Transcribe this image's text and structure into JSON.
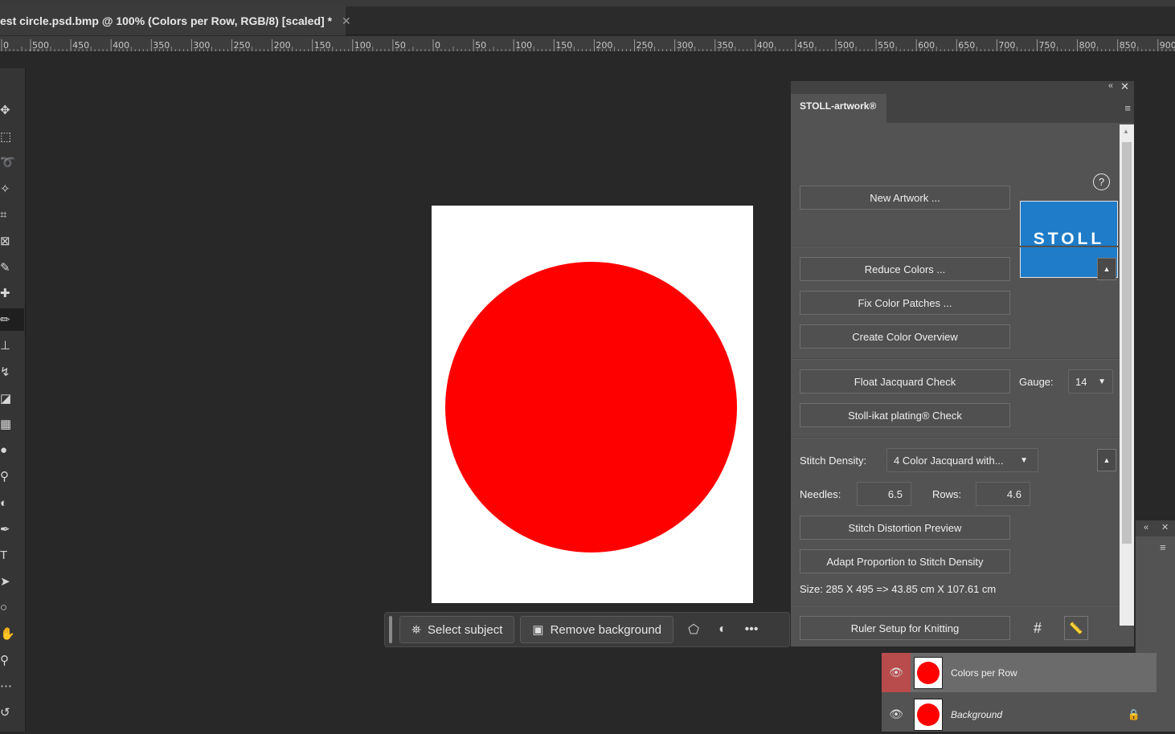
{
  "document_tab": {
    "title": "est circle.psd.bmp @ 100% (Colors per Row, RGB/8) [scaled] *",
    "close_glyph": "✕"
  },
  "ruler": {
    "labels": [
      "0",
      "500",
      "450",
      "400",
      "350",
      "300",
      "250",
      "200",
      "150",
      "100",
      "50",
      "0",
      "50",
      "100",
      "150",
      "200",
      "250",
      "300",
      "350",
      "400",
      "450",
      "500",
      "550",
      "600",
      "650",
      "700",
      "750",
      "800",
      "850",
      "900"
    ]
  },
  "toolbar": {
    "tools": [
      {
        "name": "move-tool-icon",
        "glyph": "✥"
      },
      {
        "name": "marquee-tool-icon",
        "glyph": "⬚"
      },
      {
        "name": "lasso-tool-icon",
        "glyph": "➰"
      },
      {
        "name": "magic-wand-icon",
        "glyph": "✧"
      },
      {
        "name": "crop-tool-icon",
        "glyph": "⌗"
      },
      {
        "name": "frame-tool-icon",
        "glyph": "⊠"
      },
      {
        "name": "eyedropper-icon",
        "glyph": "✎"
      },
      {
        "name": "healing-brush-icon",
        "glyph": "✚"
      },
      {
        "name": "pencil-tool-icon",
        "glyph": "✏"
      },
      {
        "name": "stamp-tool-icon",
        "glyph": "⊥"
      },
      {
        "name": "history-brush-icon",
        "glyph": "↯"
      },
      {
        "name": "eraser-tool-icon",
        "glyph": "◪"
      },
      {
        "name": "gradient-tool-icon",
        "glyph": "▦"
      },
      {
        "name": "blur-tool-icon",
        "glyph": "●"
      },
      {
        "name": "dodge-tool-icon",
        "glyph": "⚲"
      },
      {
        "name": "sponge-tool-icon",
        "glyph": "◐"
      },
      {
        "name": "pen-tool-icon",
        "glyph": "✒"
      },
      {
        "name": "type-tool-icon",
        "glyph": "T"
      },
      {
        "name": "path-select-icon",
        "glyph": "➤"
      },
      {
        "name": "ellipse-tool-icon",
        "glyph": "○"
      },
      {
        "name": "hand-tool-icon",
        "glyph": "✋"
      },
      {
        "name": "zoom-tool-icon",
        "glyph": "⚲"
      },
      {
        "name": "more-tools-icon",
        "glyph": "⋯"
      },
      {
        "name": "swap-colors-icon",
        "glyph": "↺"
      }
    ]
  },
  "contextual_bar": {
    "select_subject": "Select subject",
    "remove_background": "Remove background",
    "select_subject_glyph": "⛯",
    "remove_bg_glyph": "▣",
    "transform_glyph": "⬠",
    "adjust_glyph": "◐",
    "more_glyph": "•••"
  },
  "panel": {
    "tab_title": "STOLL-artwork®",
    "collapse_glyph": "«",
    "close_glyph": "✕",
    "menu_glyph": "≡",
    "help_glyph": "?",
    "logo_text": "STOLL",
    "buttons": {
      "new_artwork": "New Artwork ...",
      "reduce_colors": "Reduce Colors ...",
      "fix_color_patches": "Fix Color Patches ...",
      "create_color_overview": "Create Color Overview",
      "float_jacquard_check": "Float Jacquard Check",
      "stoll_ikat_check": "Stoll-ikat plating® Check",
      "stitch_distortion_preview": "Stitch Distortion Preview",
      "adapt_proportion": "Adapt Proportion to Stitch Density",
      "ruler_setup": "Ruler Setup for Knitting"
    },
    "gauge_label": "Gauge:",
    "gauge_value": "14",
    "stitch_density_label": "Stitch Density:",
    "stitch_density_value": "4 Color Jacquard with...",
    "needles_label": "Needles:",
    "needles_value": "6.5",
    "rows_label": "Rows:",
    "rows_value": "4.6",
    "size_text": "Size: 285 X 495 => 43.85 cm X 107.61 cm",
    "up_glyph": "▲",
    "dropdown_glyph": "▼",
    "grid_glyph": "#",
    "ruler_glyph": "📏"
  },
  "panel2": {
    "collapse_glyph": "«",
    "close_glyph": "✕",
    "menu_glyph": "≡"
  },
  "layers": [
    {
      "name": "Colors per Row",
      "selected": true,
      "italic": false,
      "locked": false
    },
    {
      "name": "Background",
      "selected": false,
      "italic": true,
      "locked": true
    }
  ],
  "layer_glyphs": {
    "eye": "👁",
    "lock": "🔒"
  },
  "colors": {
    "canvas_bg": "#282828",
    "panel_bg": "#535353",
    "stoll_blue": "#1e7cc8",
    "circle_red": "#ff0000",
    "layer_eye_active": "#b84b4b"
  }
}
